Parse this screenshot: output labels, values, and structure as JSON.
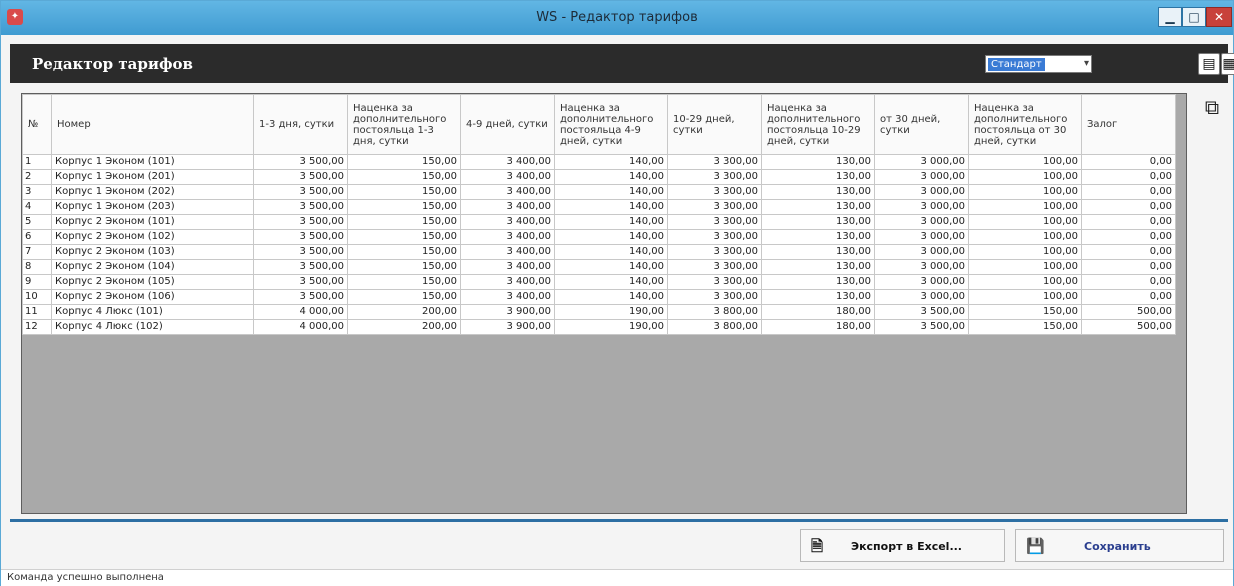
{
  "window": {
    "title": "WS - Редактор тарифов"
  },
  "header": {
    "title": "Редактор тарифов",
    "tariff_select": "Стандарт"
  },
  "icons": {
    "app": "app-icon",
    "calendar": "calendar-icon",
    "grid": "table-grid-icon",
    "copy": "copy-icon",
    "excel": "excel-file-icon",
    "save": "floppy-disk-icon"
  },
  "table": {
    "columns": [
      "№",
      "Номер",
      "1-3 дня, сутки",
      "Наценка за дополнительного постояльца 1-3 дня, сутки",
      "4-9 дней, сутки",
      "Наценка за дополнительного постояльца 4-9 дней, сутки",
      "10-29 дней, сутки",
      "Наценка за дополнительного постояльца 10-29 дней, сутки",
      "от 30 дней, сутки",
      "Наценка за дополнительного постояльца от 30 дней, сутки",
      "Залог"
    ],
    "rows": [
      [
        "1",
        "Корпус 1 Эконом (101)",
        "3 500,00",
        "150,00",
        "3 400,00",
        "140,00",
        "3 300,00",
        "130,00",
        "3 000,00",
        "100,00",
        "0,00"
      ],
      [
        "2",
        "Корпус 1 Эконом (201)",
        "3 500,00",
        "150,00",
        "3 400,00",
        "140,00",
        "3 300,00",
        "130,00",
        "3 000,00",
        "100,00",
        "0,00"
      ],
      [
        "3",
        "Корпус 1 Эконом (202)",
        "3 500,00",
        "150,00",
        "3 400,00",
        "140,00",
        "3 300,00",
        "130,00",
        "3 000,00",
        "100,00",
        "0,00"
      ],
      [
        "4",
        "Корпус 1 Эконом (203)",
        "3 500,00",
        "150,00",
        "3 400,00",
        "140,00",
        "3 300,00",
        "130,00",
        "3 000,00",
        "100,00",
        "0,00"
      ],
      [
        "5",
        "Корпус 2 Эконом (101)",
        "3 500,00",
        "150,00",
        "3 400,00",
        "140,00",
        "3 300,00",
        "130,00",
        "3 000,00",
        "100,00",
        "0,00"
      ],
      [
        "6",
        "Корпус 2 Эконом (102)",
        "3 500,00",
        "150,00",
        "3 400,00",
        "140,00",
        "3 300,00",
        "130,00",
        "3 000,00",
        "100,00",
        "0,00"
      ],
      [
        "7",
        "Корпус 2 Эконом (103)",
        "3 500,00",
        "150,00",
        "3 400,00",
        "140,00",
        "3 300,00",
        "130,00",
        "3 000,00",
        "100,00",
        "0,00"
      ],
      [
        "8",
        "Корпус 2 Эконом (104)",
        "3 500,00",
        "150,00",
        "3 400,00",
        "140,00",
        "3 300,00",
        "130,00",
        "3 000,00",
        "100,00",
        "0,00"
      ],
      [
        "9",
        "Корпус 2 Эконом (105)",
        "3 500,00",
        "150,00",
        "3 400,00",
        "140,00",
        "3 300,00",
        "130,00",
        "3 000,00",
        "100,00",
        "0,00"
      ],
      [
        "10",
        "Корпус 2 Эконом (106)",
        "3 500,00",
        "150,00",
        "3 400,00",
        "140,00",
        "3 300,00",
        "130,00",
        "3 000,00",
        "100,00",
        "0,00"
      ],
      [
        "11",
        "Корпус 4 Люкс (101)",
        "4 000,00",
        "200,00",
        "3 900,00",
        "190,00",
        "3 800,00",
        "180,00",
        "3 500,00",
        "150,00",
        "500,00"
      ],
      [
        "12",
        "Корпус 4 Люкс (102)",
        "4 000,00",
        "200,00",
        "3 900,00",
        "190,00",
        "3 800,00",
        "180,00",
        "3 500,00",
        "150,00",
        "500,00"
      ]
    ]
  },
  "buttons": {
    "export": "Экспорт в Excel...",
    "save": "Сохранить"
  },
  "status": {
    "text": "Команда успешно выполнена"
  },
  "colors": {
    "titlebar": "#4aa6da",
    "header": "#2b2b2b",
    "divider": "#2d6fa3",
    "close": "#c8413b",
    "select_highlight": "#3a7bd5"
  }
}
